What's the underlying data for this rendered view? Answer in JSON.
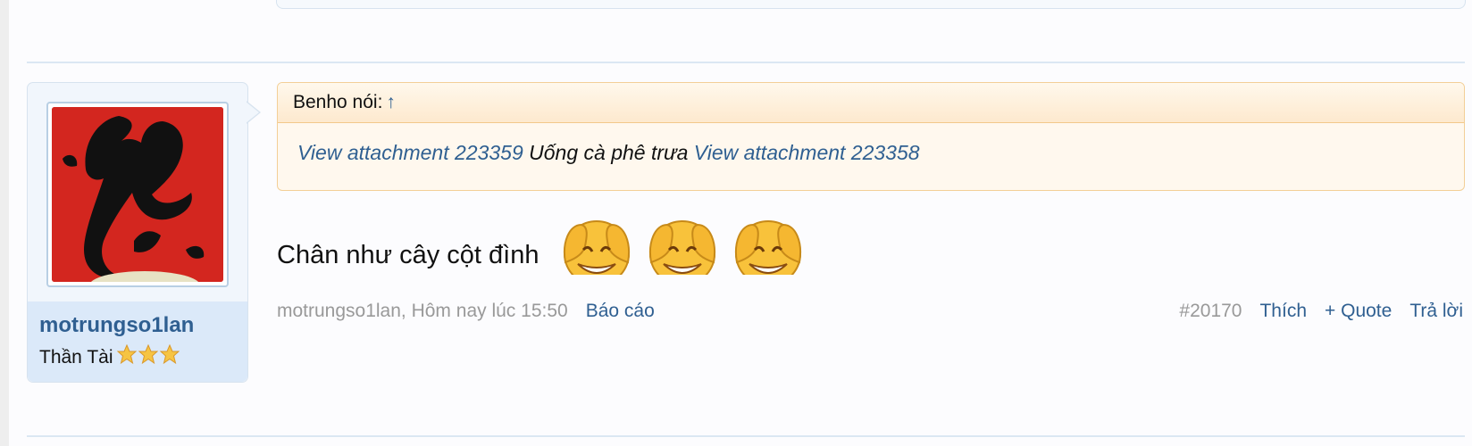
{
  "post": {
    "author": {
      "username": "motrungso1lan",
      "title": "Thần Tài"
    },
    "quote": {
      "header": "Benho nói:",
      "up_arrow": "↑",
      "attachment_1": "View attachment 223359",
      "text": "Uống cà phê trưa",
      "attachment_2": "View attachment 223358"
    },
    "message": "Chân như cây cột đình",
    "meta": {
      "author_time": "motrungso1lan, Hôm nay lúc 15:50",
      "report": "Báo cáo",
      "post_number": "#20170",
      "like": "Thích",
      "quote": "+ Quote",
      "reply": "Trả lời"
    }
  },
  "colors": {
    "link": "#2f5f91",
    "muted": "#999999",
    "quote_border": "#f3cf97",
    "card_bg": "#f1f6fc"
  },
  "icons": [
    "star-icon",
    "laughing-emoji-icon",
    "up-arrow-icon"
  ]
}
